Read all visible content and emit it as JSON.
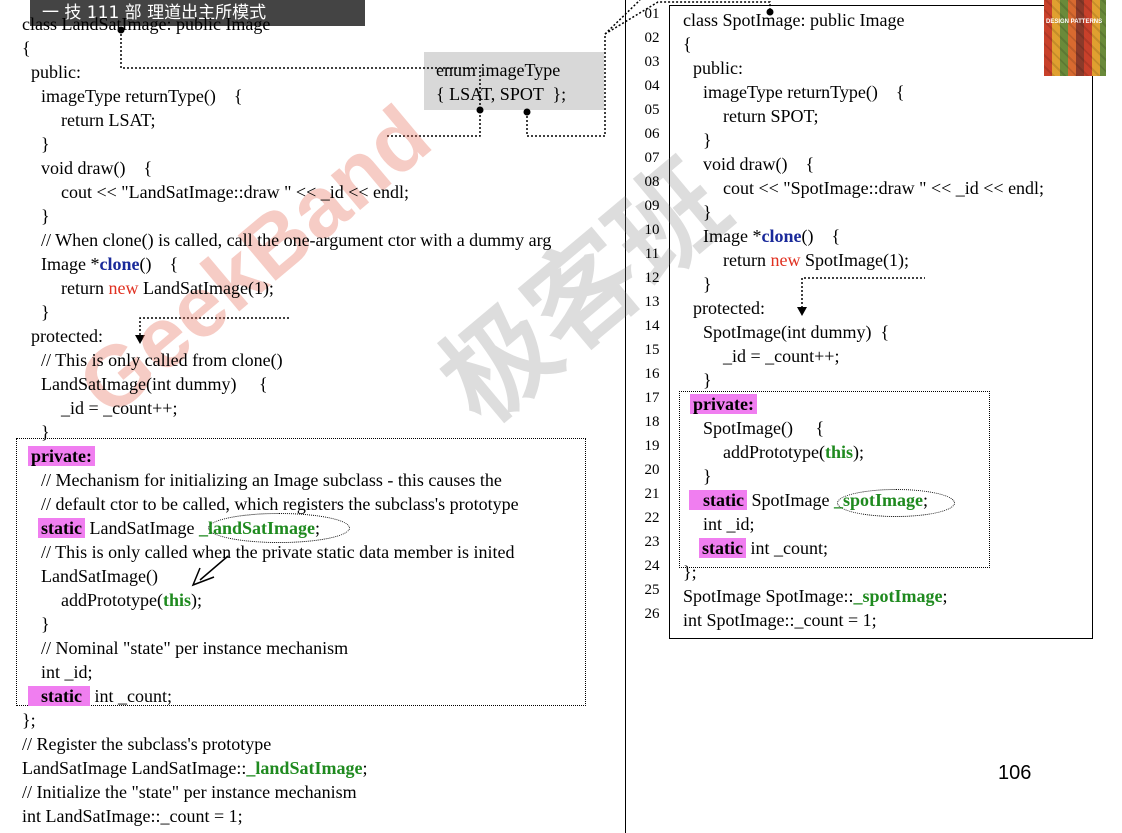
{
  "header": {
    "banner_text": "一 技 111 部 理道出主所模式"
  },
  "enum_box": {
    "line1": "enum imageType",
    "line2": "{ LSAT, SPOT  };"
  },
  "left_code": {
    "l01": "class LandSatImage: public Image",
    "l02": "{",
    "l03": "public:",
    "l04": "imageType returnType()    {",
    "l05": "return LSAT;",
    "l06": "}",
    "l07": "void draw()    {",
    "l08": "cout << \"LandSatImage::draw \" << _id << endl;",
    "l09": "}",
    "l10": "// When clone() is called, call the one-argument ctor with a dummy arg",
    "l11a": "Image *",
    "l11b": "clone",
    "l11c": "()    {",
    "l12a": "return ",
    "l12b": "new",
    "l12c": " LandSatImage(1);",
    "l13": "}",
    "l14": "protected:",
    "l15": "// This is only called from clone()",
    "l16": "LandSatImage(int dummy)     {",
    "l17": "_id = _count++;",
    "l18": "}",
    "l19": "private:",
    "l20": "// Mechanism for initializing an Image subclass - this causes the",
    "l21": "// default ctor to be called, which registers the subclass's prototype",
    "l22a": "static",
    "l22b": " LandSatImage ",
    "l22c": "_landSatImage",
    "l22d": ";",
    "l23": "// This is only called when the private static data member is inited",
    "l24": "LandSatImage()",
    "l25a": "addPrototype(",
    "l25b": "this",
    "l25c": ");",
    "l26": "}",
    "l27": "// Nominal \"state\" per instance mechanism",
    "l28": "int _id;",
    "l29a": "static",
    "l29b": " int _count;",
    "l30": "};",
    "l31": "// Register the subclass's prototype",
    "l32a": "LandSatImage LandSatImage::",
    "l32b": "_landSatImage",
    "l32c": ";",
    "l33": "// Initialize the \"state\" per instance mechanism",
    "l34": "int LandSatImage::_count = 1;"
  },
  "line_numbers": [
    "01",
    "02",
    "03",
    "04",
    "05",
    "06",
    "07",
    "08",
    "09",
    "10",
    "11",
    "12",
    "13",
    "14",
    "15",
    "16",
    "17",
    "18",
    "19",
    "20",
    "21",
    "22",
    "23",
    "24",
    "25",
    "26"
  ],
  "right_code": {
    "r01": "class SpotImage: public Image",
    "r02": "{",
    "r03": "public:",
    "r04": "imageType returnType()    {",
    "r05": "return SPOT;",
    "r06": "}",
    "r07": "void draw()    {",
    "r08": "cout << \"SpotImage::draw \" << _id << endl;",
    "r09": "}",
    "r10a": "Image *",
    "r10b": "clone",
    "r10c": "()    {",
    "r11a": "return ",
    "r11b": "new",
    "r11c": " SpotImage(1);",
    "r12": "}",
    "r13": "protected:",
    "r14": "SpotImage(int dummy)  {",
    "r15": "_id = _count++;",
    "r16": "}",
    "r17": "private:",
    "r18": "SpotImage()     {",
    "r19a": "addPrototype(",
    "r19b": "this",
    "r19c": ");",
    "r20": "}",
    "r21a": "static",
    "r21b": " SpotImage ",
    "r21c": "_spotImage",
    "r21d": ";",
    "r22": "int _id;",
    "r23a": "static",
    "r23b": " int _count;",
    "r24": "};",
    "r25a": "SpotImage SpotImage::",
    "r25b": "_spotImage",
    "r25c": ";",
    "r26": "int SpotImage::_count = 1;"
  },
  "page_number": "106",
  "book_cover_text": "DESIGN PATTERNS",
  "watermark": {
    "text1": "GeekBand",
    "text2": "极客班"
  },
  "colors": {
    "keyword_red": "#e03020",
    "keyword_blue": "#1a2a9a",
    "identifier_green": "#1f8a1f",
    "highlight_pink": "#f07ef0"
  }
}
